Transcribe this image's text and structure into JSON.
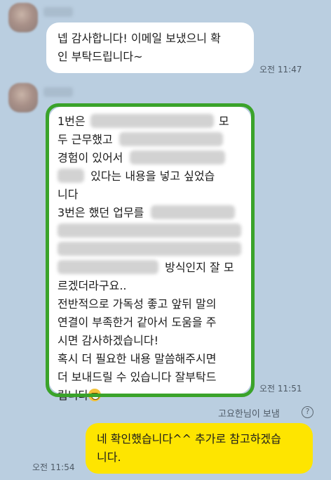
{
  "messages": [
    {
      "lines": [
        "넵 감사합니다! 이메일 보냈으니 확",
        "인 부탁드립니다~"
      ],
      "time": "오전 11:47"
    },
    {
      "segments": {
        "l1a": "1번은",
        "l1b": "모",
        "l2a": "두 근무했고",
        "l3a": "경험이 있어서",
        "l4a": "있다는 내용을 넣고 싶었습",
        "l5a": "니다",
        "l6a": "3번은 했던 업무를",
        "l9a": "방식인지 잘 모",
        "l10a": "르겠더라구요..",
        "l11a": "전반적으로 가독성 좋고 앞뒤 말의",
        "l12a": "연결이 부족한거 같아서 도움을 주",
        "l13a": "시면 감사하겠습니다!",
        "l14a": "혹시 더 필요한 내용 말씀해주시면",
        "l15a": "더 보내드릴 수 있습니다 잘부탁드",
        "l16a": "립니다"
      },
      "emoji": "grinning-sweat-emoji",
      "time": "오전 11:51"
    }
  ],
  "sent_by": "고요한님이 보냄",
  "sent_by_icon": "question-icon",
  "question_glyph": "?",
  "my_reply": {
    "lines": [
      "네 확인했습니다^^ 추가로 참고하겠습",
      "니다."
    ],
    "time": "오전 11:54"
  },
  "colors": {
    "background": "#bacee0",
    "my_bubble": "#fee500",
    "highlight": "#3aa32a"
  }
}
